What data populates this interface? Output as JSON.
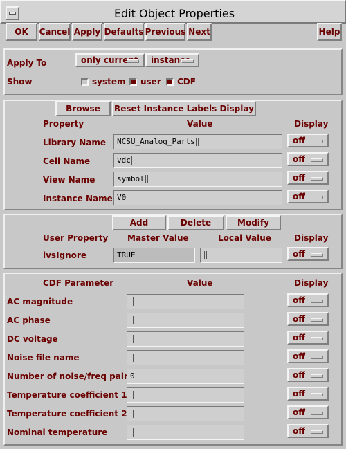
{
  "window": {
    "title": "Edit Object Properties"
  },
  "toolbar": {
    "ok": "OK",
    "cancel": "Cancel",
    "apply": "Apply",
    "defaults": "Defaults",
    "previous": "Previous",
    "next": "Next",
    "help": "Help"
  },
  "apply_to": {
    "label": "Apply To",
    "scope": "only current",
    "target": "instance"
  },
  "show": {
    "label": "Show",
    "options": [
      {
        "label": "system",
        "checked": false
      },
      {
        "label": "user",
        "checked": true
      },
      {
        "label": "CDF",
        "checked": true
      }
    ]
  },
  "instance_section": {
    "browse": "Browse",
    "reset_labels": "Reset Instance Labels Display",
    "headers": {
      "property": "Property",
      "value": "Value",
      "display": "Display"
    },
    "rows": [
      {
        "label": "Library Name",
        "value": "NCSU_Analog_Parts",
        "display": "off"
      },
      {
        "label": "Cell Name",
        "value": "vdc",
        "display": "off"
      },
      {
        "label": "View Name",
        "value": "symbol",
        "display": "off"
      },
      {
        "label": "Instance Name",
        "value": "V0",
        "display": "off"
      }
    ]
  },
  "user_section": {
    "add": "Add",
    "delete": "Delete",
    "modify": "Modify",
    "headers": {
      "property": "User Property",
      "master": "Master Value",
      "local": "Local Value",
      "display": "Display"
    },
    "rows": [
      {
        "label": "lvsIgnore",
        "master": "TRUE",
        "local": "",
        "display": "off"
      }
    ]
  },
  "cdf_section": {
    "headers": {
      "param": "CDF Parameter",
      "value": "Value",
      "display": "Display"
    },
    "rows": [
      {
        "label": "AC magnitude",
        "value": "",
        "display": "off"
      },
      {
        "label": "AC phase",
        "value": "",
        "display": "off"
      },
      {
        "label": "DC voltage",
        "value": "",
        "display": "off"
      },
      {
        "label": "Noise file name",
        "value": "",
        "display": "off"
      },
      {
        "label": "Number of noise/freq pairs",
        "value": "0",
        "display": "off"
      },
      {
        "label": "Temperature coefficient 1",
        "value": "",
        "display": "off"
      },
      {
        "label": "Temperature coefficient 2",
        "value": "",
        "display": "off"
      },
      {
        "label": "Nominal temperature",
        "value": "",
        "display": "off"
      }
    ]
  },
  "colors": {
    "label": "#6b0000",
    "background": "#c8c8c8"
  }
}
